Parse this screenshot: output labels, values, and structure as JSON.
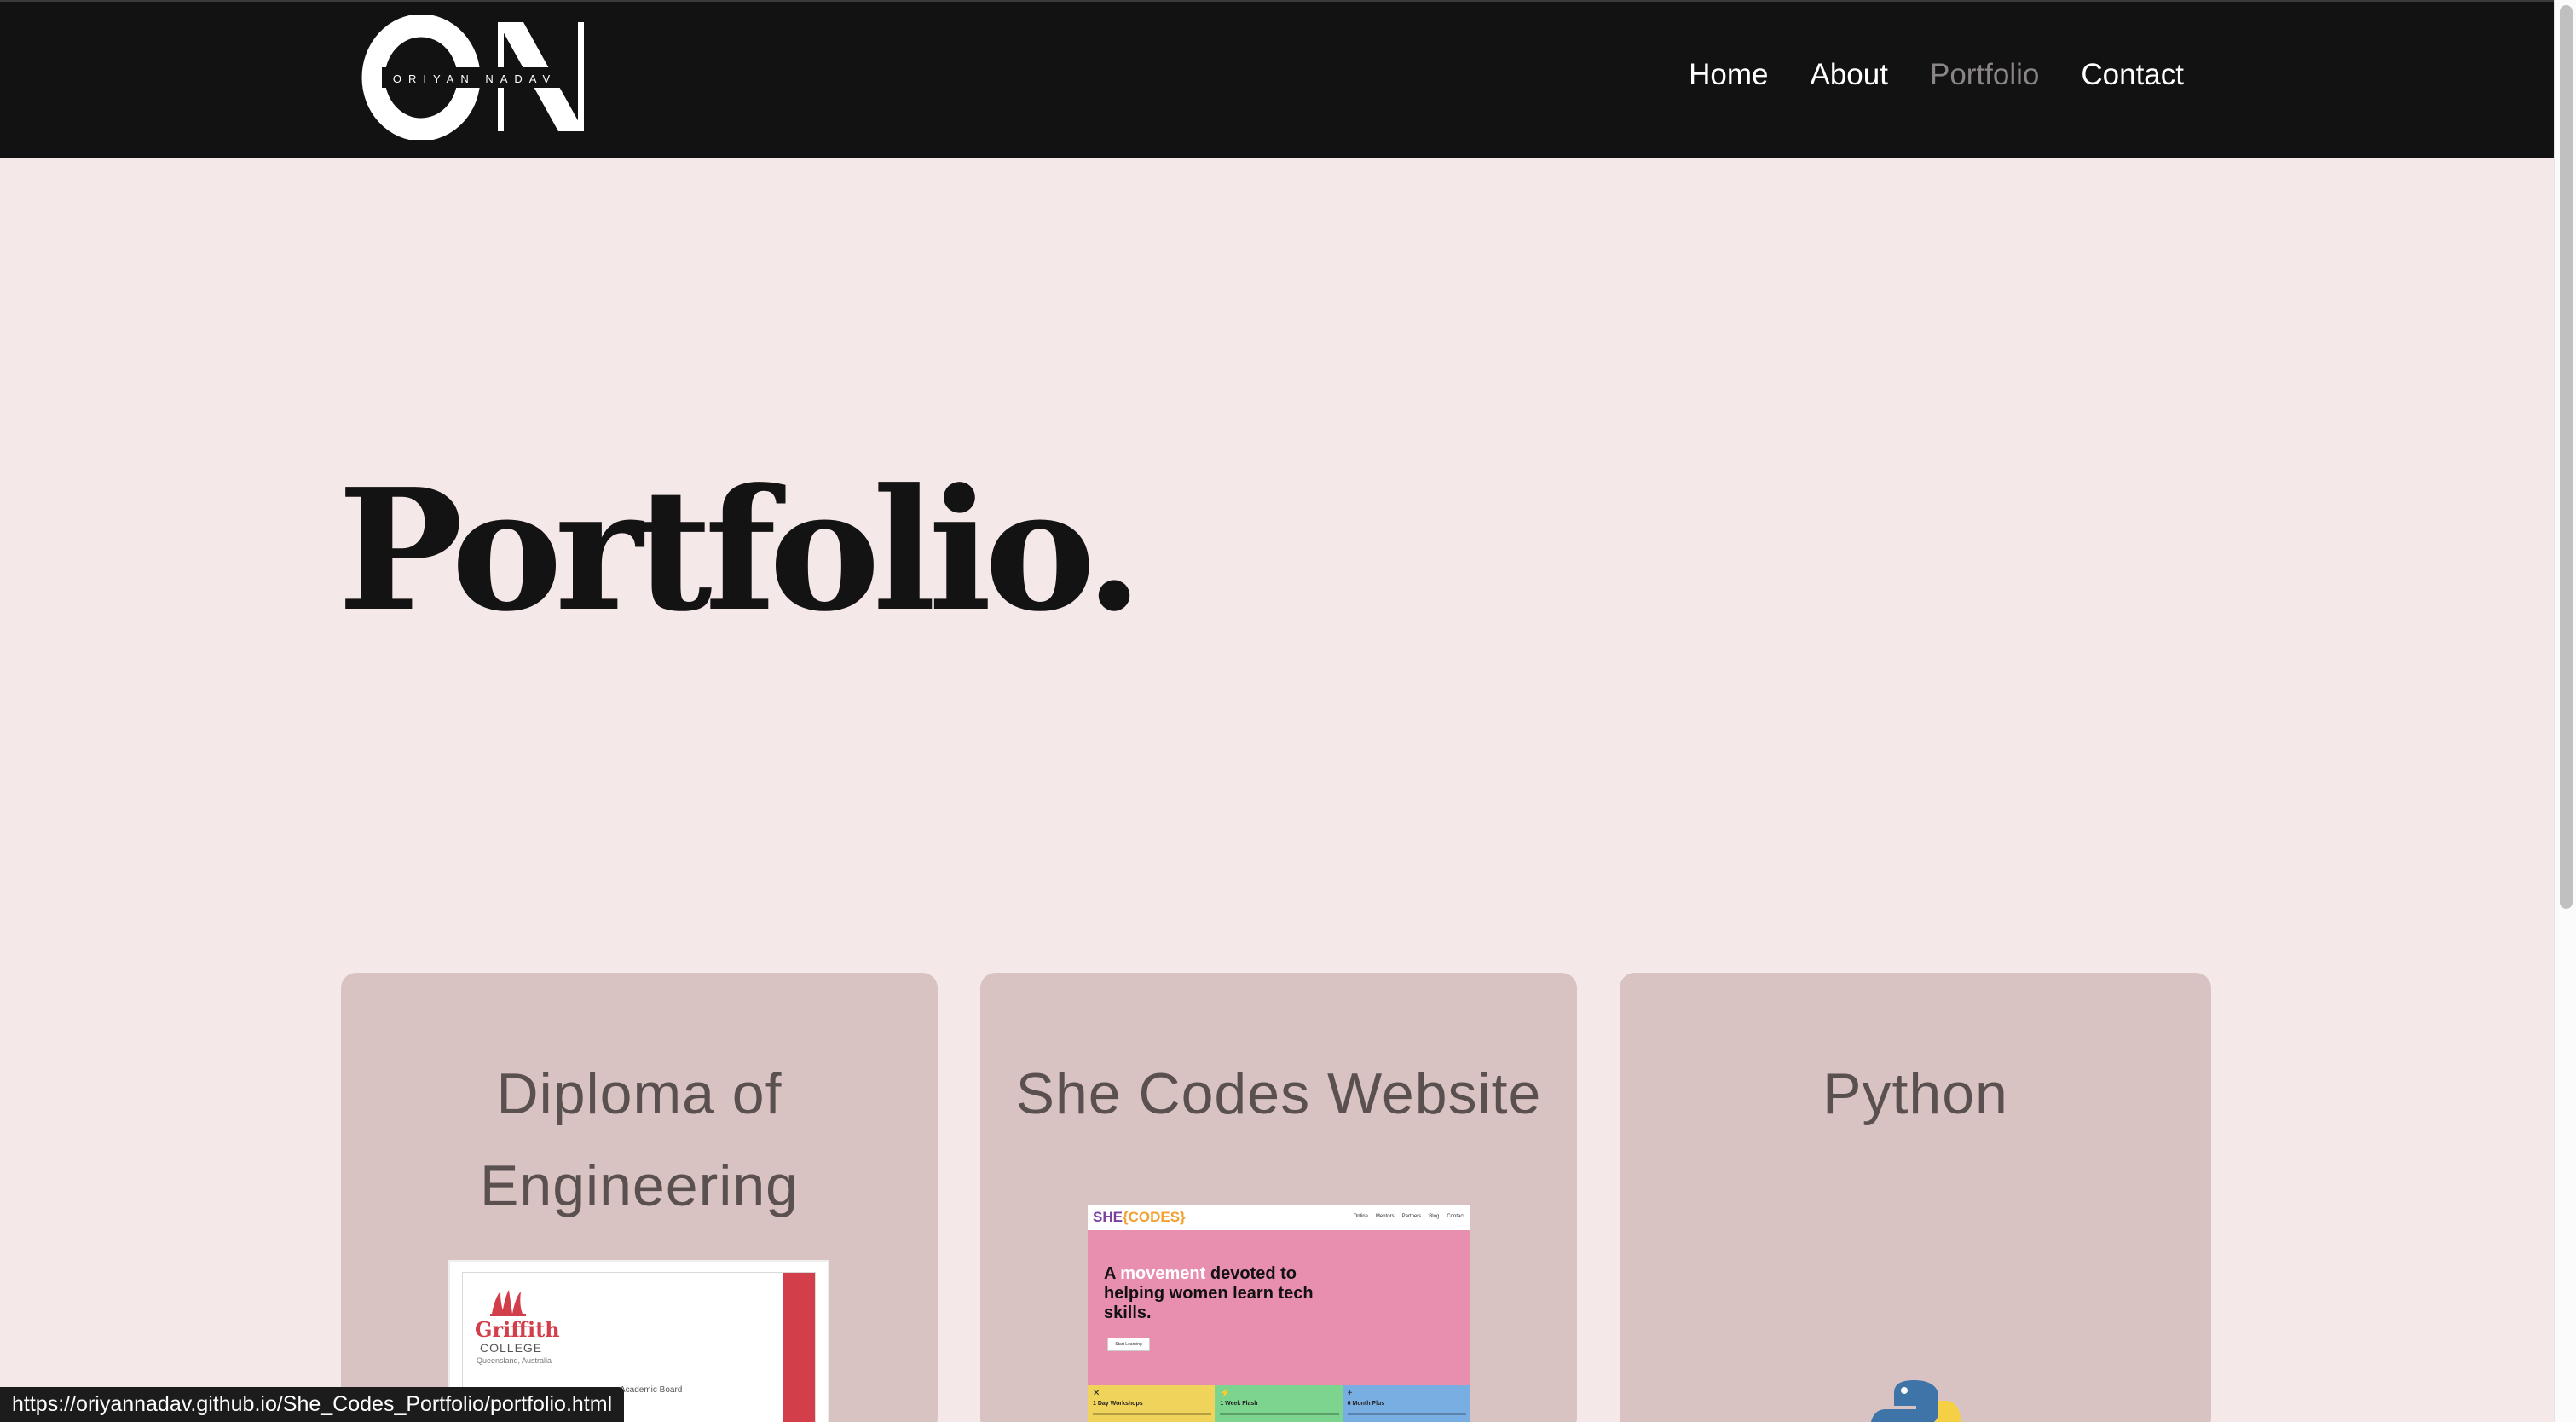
{
  "header": {
    "logo_monogram": "ON",
    "logo_name": "ORIYAN NADAV",
    "nav": [
      {
        "label": "Home",
        "active": false
      },
      {
        "label": "About",
        "active": false
      },
      {
        "label": "Portfolio",
        "active": true
      },
      {
        "label": "Contact",
        "active": false
      }
    ]
  },
  "main": {
    "page_title": "Portfolio.",
    "cards": [
      {
        "title": "Diploma of Engineering",
        "image": {
          "type": "certificate",
          "brand": "Griffith",
          "college": "COLLEGE",
          "place": "Queensland, Australia",
          "board": "Academic Board"
        }
      },
      {
        "title": "She Codes Website",
        "image": {
          "type": "website-screenshot",
          "brand_a": "SHE",
          "brand_b": "{CODES}",
          "links": [
            "Online",
            "Mentors",
            "Partners",
            "Blog",
            "Contact"
          ],
          "heading_a": "A ",
          "heading_highlight": "movement",
          "heading_b": " devoted to helping women learn tech skills.",
          "button": "Start Learning",
          "tiles": [
            "1 Day Workshops",
            "1 Week Flash",
            "6 Month Plus"
          ]
        }
      },
      {
        "title": "Python",
        "image": {
          "type": "python-logo-icon"
        }
      }
    ]
  },
  "status_bar": {
    "url": "https://oriyannadav.github.io/She_Codes_Portfolio/portfolio.html"
  },
  "colors": {
    "header_bg": "#131212",
    "page_bg": "#f5e8e8",
    "card_bg": "#d8c2c2",
    "nav_active": "#8a8585",
    "title_text": "#141313",
    "card_title": "#5a5050"
  }
}
